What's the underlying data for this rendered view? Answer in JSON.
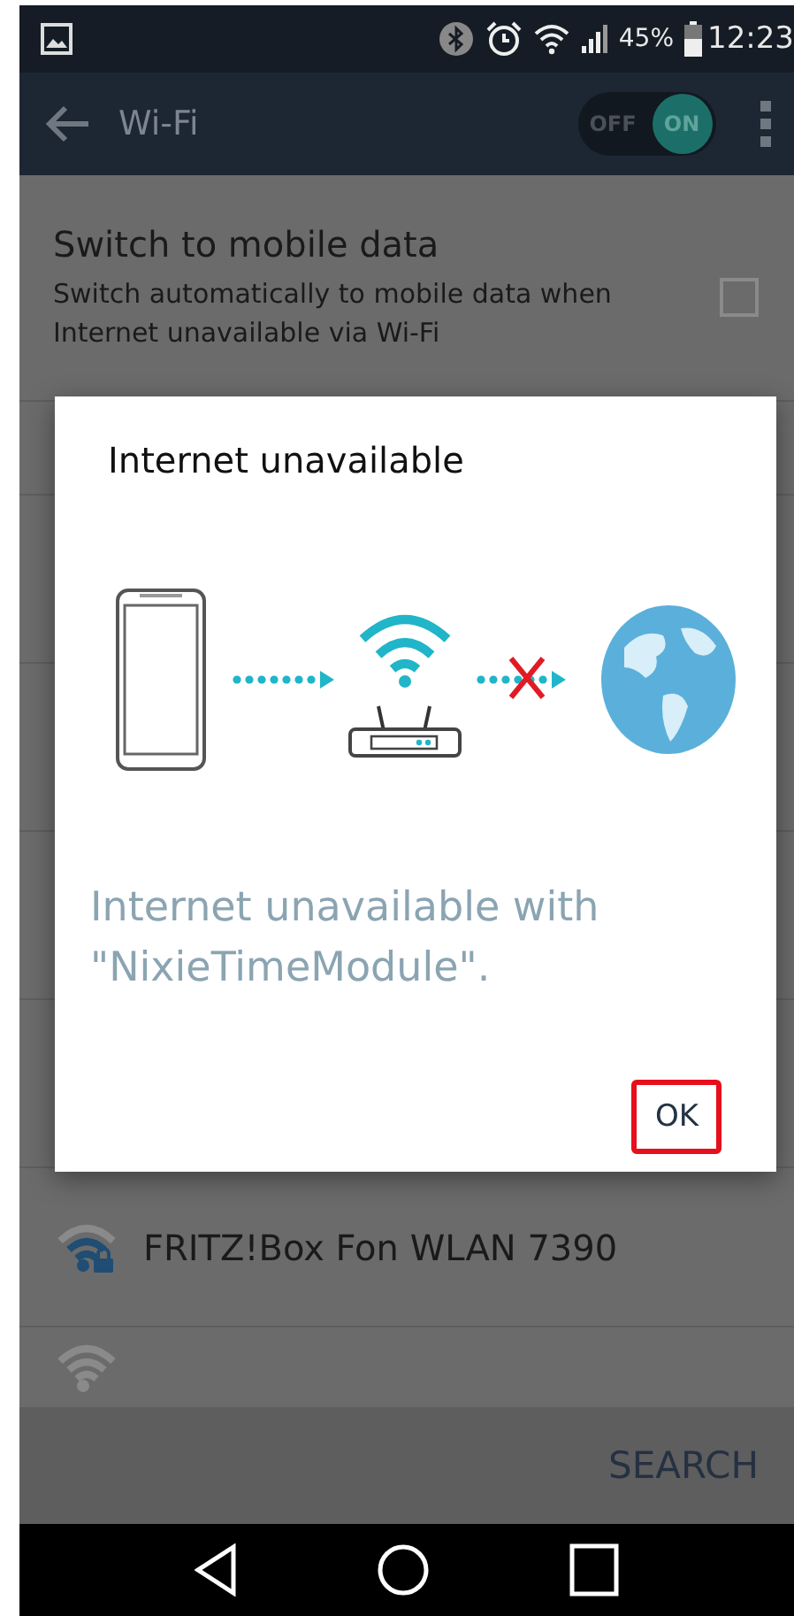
{
  "status_bar": {
    "battery": "45%",
    "time": "12:23"
  },
  "toolbar": {
    "title": "Wi-Fi",
    "toggle": {
      "off_label": "OFF",
      "on_label": "ON",
      "on": true
    }
  },
  "mobile_data": {
    "title": "Switch to mobile data",
    "description": "Switch automatically to mobile data when Internet unavailable via Wi-Fi",
    "checked": false
  },
  "networks": [
    {
      "name": "FRITZ!Box Fon WLAN 7390",
      "secured": true
    }
  ],
  "dialog": {
    "title": "Internet unavailable",
    "message": "Internet unavailable with \"NixieTimeModule\".",
    "button": "OK",
    "button_focused": true
  },
  "bottom_bar": {
    "action": "SEARCH"
  }
}
